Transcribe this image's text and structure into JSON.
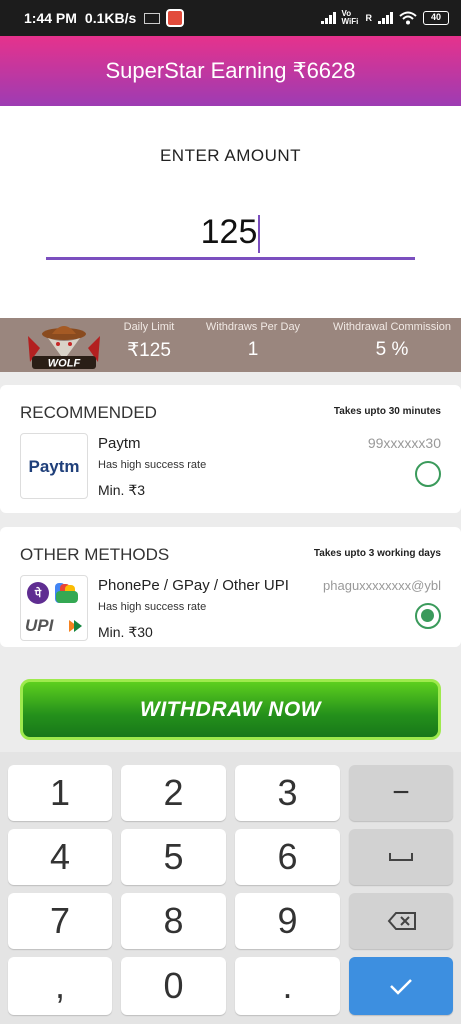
{
  "status_bar": {
    "time": "1:44 PM",
    "speed": "0.1KB/s",
    "network_label": "Vo WiFi",
    "roaming": "R",
    "battery": "40"
  },
  "header": {
    "title": "SuperStar Earning ₹6628"
  },
  "amount": {
    "label": "ENTER AMOUNT",
    "value": "125"
  },
  "limits": {
    "brand": "WOLF",
    "daily_limit_label": "Daily Limit",
    "daily_limit_value": "₹125",
    "withdraws_label": "Withdraws Per Day",
    "withdraws_value": "1",
    "commission_label": "Withdrawal Commission",
    "commission_value": "5 %"
  },
  "recommended": {
    "title": "RECOMMENDED",
    "note": "Takes upto 30 minutes",
    "method": {
      "name": "Paytm",
      "sub": "Has high success rate",
      "min": "Min. ₹3",
      "account": "99xxxxxx30",
      "selected": false,
      "logo_text": "Paytm"
    }
  },
  "other": {
    "title": "OTHER METHODS",
    "note": "Takes upto 3 working days",
    "method": {
      "name": "PhonePe / GPay / Other UPI",
      "sub": "Has high success rate",
      "min": "Min. ₹30",
      "account": "phaguxxxxxxxx@ybl",
      "selected": true,
      "logo_text": "UPI"
    }
  },
  "withdraw_button": "WITHDRAW NOW",
  "keypad": {
    "k1": "1",
    "k2": "2",
    "k3": "3",
    "minus": "−",
    "k4": "4",
    "k5": "5",
    "k6": "6",
    "k7": "7",
    "k8": "8",
    "k9": "9",
    "comma": ",",
    "k0": "0",
    "dot": "."
  },
  "colors": {
    "header_top": "#e6328c",
    "header_bottom": "#9d3cb3",
    "accent": "#7b4fbf",
    "radio_green": "#3a9a5b",
    "withdraw_green": "#24901b",
    "keyboard_ok": "#3d8fe0"
  },
  "icons": [
    "app-notification-icon",
    "signal-icon",
    "wifi-icon",
    "battery-icon",
    "wolf-logo-icon",
    "paytm-logo-icon",
    "phonepe-icon",
    "gpay-icon",
    "upi-logo-icon",
    "space-icon",
    "backspace-icon",
    "check-icon"
  ]
}
